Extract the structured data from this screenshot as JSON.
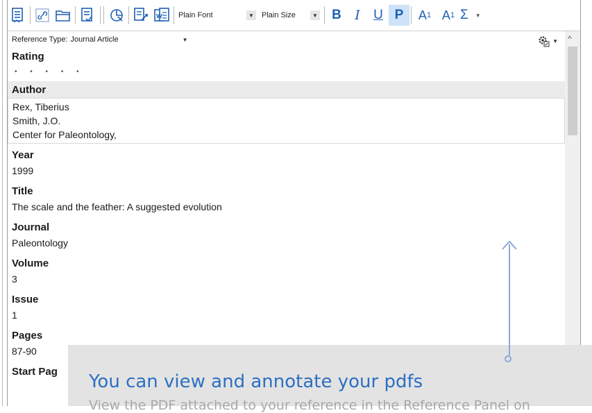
{
  "toolbar": {
    "icons": [
      "insert-citation-icon",
      "attach-link-icon",
      "open-folder-icon",
      "format-bibliography-icon",
      "track-changes-icon",
      "export-icon",
      "word-icon"
    ],
    "font_select": "Plain Font",
    "size_select": "Plain Size",
    "bold": "B",
    "italic": "I",
    "underline": "U",
    "plain": "P",
    "superscript_base": "A",
    "superscript": "1",
    "subscript_base": "A",
    "subscript": "1",
    "symbol": "Σ",
    "accent": "#1e5fb4"
  },
  "reference": {
    "type_label": "Reference Type:",
    "type_value": "Journal Article",
    "fields": {
      "rating_label": "Rating",
      "rating_dots": "• • • • •",
      "author_label": "Author",
      "authors": [
        "Rex, Tiberius",
        "Smith, J.O.",
        "Center for Paleontology,"
      ],
      "year_label": "Year",
      "year_value": "1999",
      "title_label": "Title",
      "title_value": "The scale and the feather: A suggested evolution",
      "journal_label": "Journal",
      "journal_value": "Paleontology",
      "volume_label": "Volume",
      "volume_value": "3",
      "issue_label": "Issue",
      "issue_value": "1",
      "pages_label": "Pages",
      "pages_value": "87-90",
      "startpage_label": "Start Pag"
    }
  },
  "callout": {
    "title": "You can view and annotate your pdfs",
    "text": "View the PDF attached to your reference in the Reference Panel on"
  }
}
